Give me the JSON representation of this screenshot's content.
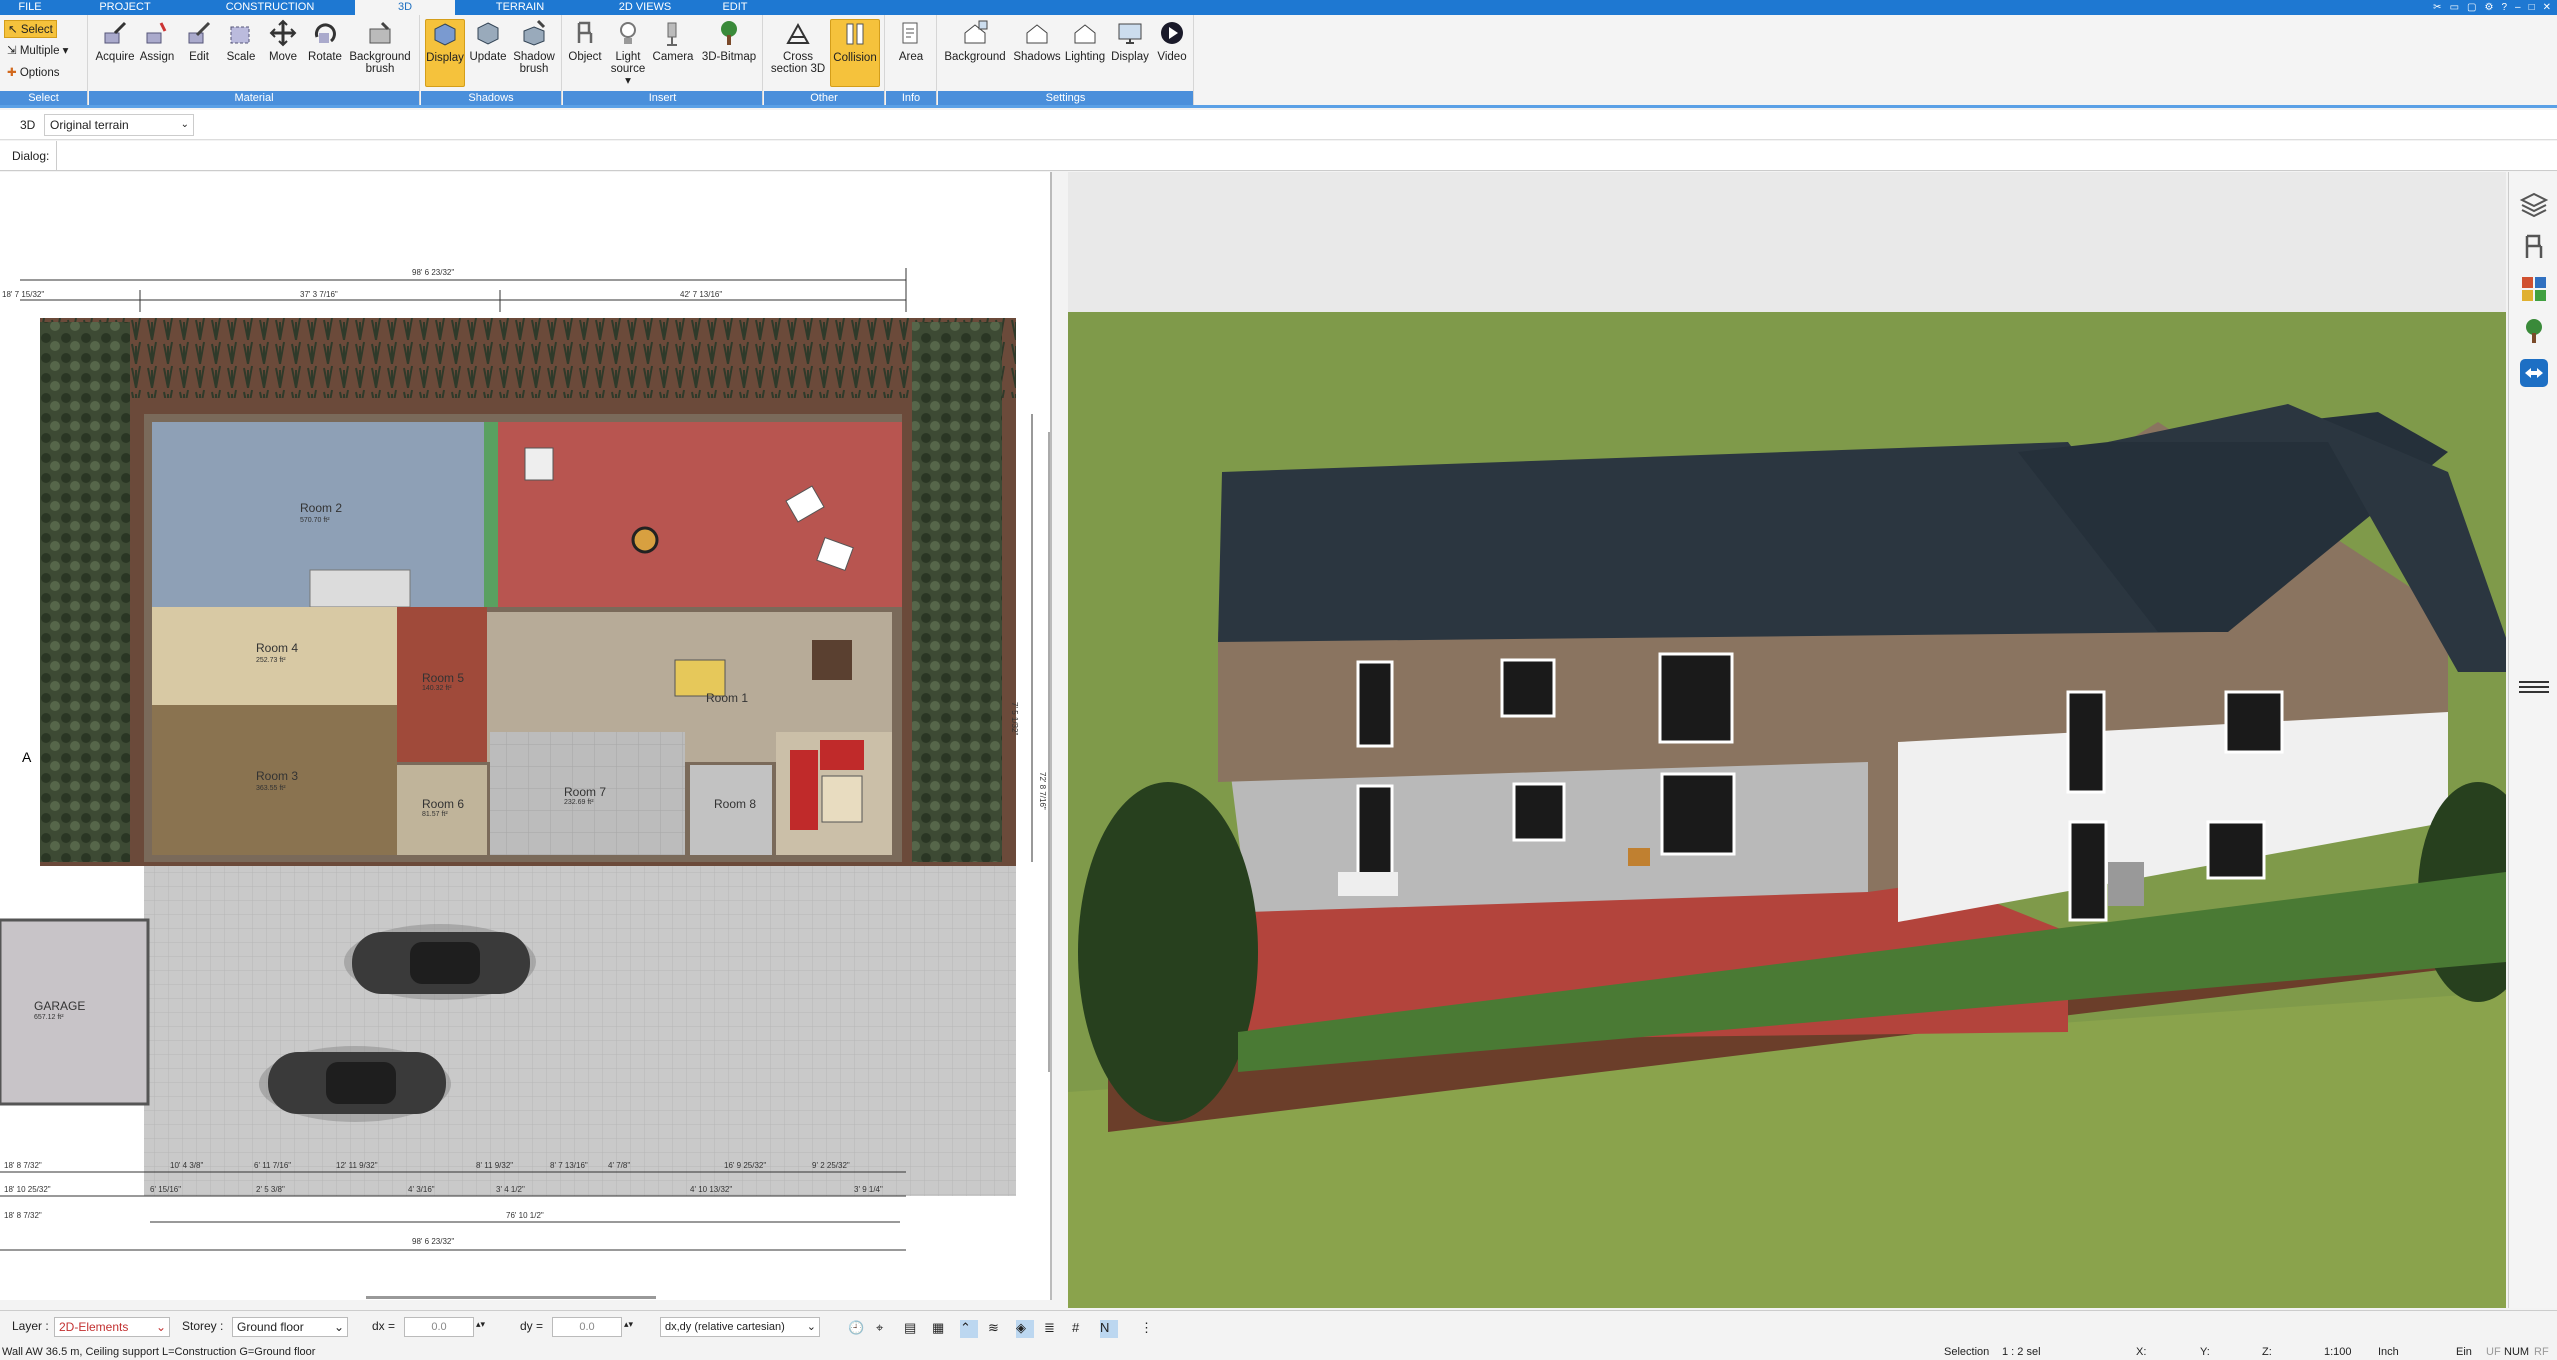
{
  "tabs": [
    {
      "label": "FILE",
      "active": false
    },
    {
      "label": "PROJECT",
      "active": false
    },
    {
      "label": "CONSTRUCTION",
      "active": false
    },
    {
      "label": "3D",
      "active": true
    },
    {
      "label": "TERRAIN",
      "active": false
    },
    {
      "label": "2D VIEWS",
      "active": false
    },
    {
      "label": "EDIT",
      "active": false
    }
  ],
  "ribbon": {
    "select": {
      "select": "Select",
      "multiple": "Multiple",
      "options": "Options",
      "group": "Select"
    },
    "material": {
      "group": "Material",
      "buttons": [
        "Acquire",
        "Assign",
        "Edit",
        "Scale",
        "Move",
        "Rotate",
        "Background brush"
      ]
    },
    "shadows": {
      "group": "Shadows",
      "buttons": [
        "Display",
        "Update",
        "Shadow brush"
      ]
    },
    "insert": {
      "group": "Insert",
      "buttons": [
        "Object",
        "Light source",
        "Camera",
        "3D-Bitmap"
      ]
    },
    "other": {
      "group": "Other",
      "buttons": [
        "Cross section 3D",
        "Collision"
      ]
    },
    "info": {
      "group": "Info",
      "buttons": [
        "Area"
      ]
    },
    "settings": {
      "group": "Settings",
      "buttons": [
        "Background",
        "Shadows",
        "Lighting",
        "Display",
        "Video"
      ]
    }
  },
  "viewbar": {
    "mode": "3D",
    "terrain": "Original terrain"
  },
  "dialog": {
    "label": "Dialog:"
  },
  "plan": {
    "rooms": [
      {
        "name": "Room 2",
        "area": "570.70 ft²"
      },
      {
        "name": "Room 4",
        "area": "252.73 ft²"
      },
      {
        "name": "Room 3",
        "area": "363.55 ft²"
      },
      {
        "name": "Room 5",
        "area": "140.32 ft²"
      },
      {
        "name": "Room 1",
        "area": ""
      },
      {
        "name": "Room 7",
        "area": "232.69 ft²"
      },
      {
        "name": "Room 6",
        "area": "81.57 ft²"
      },
      {
        "name": "Room 8",
        "area": ""
      },
      {
        "name": "GARAGE",
        "area": "657.12 ft²"
      }
    ],
    "dims_top": [
      "98' 6 23/32\"",
      "37' 3 7/16\"",
      "42' 7 13/16\"",
      "18' 7 15/32\""
    ],
    "dims_bottom": [
      "18' 8 7/32\"",
      "18' 10 25/32\"",
      "18' 8 7/32\"",
      "76' 10 1/2\"",
      "98' 6 23/32\""
    ],
    "dims_side": [
      "72' 8 7/16\"",
      "7' 5 1/32\""
    ],
    "dims_row1": [
      "10' 4 3/8\"",
      "6' 11 7/16\"",
      "12' 11 9/32\"",
      "8' 11 9/32\"",
      "8' 7 13/16\"",
      "4' 7/8\"",
      "16' 9 25/32\"",
      "9' 2 25/32\""
    ],
    "dims_row2": [
      "6' 15/16\"",
      "2' 5 3/8\"",
      "4' 3/16\"",
      "3' 4 1/2\"",
      "4' 10 13/32\"",
      "3' 9 1/4\""
    ]
  },
  "toolbar": {
    "layer_label": "Layer :",
    "layer_value": "2D-Elements",
    "storey_label": "Storey :",
    "storey_value": "Ground floor",
    "dx_label": "dx =",
    "dx_value": "0.0",
    "dy_label": "dy =",
    "dy_value": "0.0",
    "coord_mode": "dx,dy (relative cartesian)"
  },
  "status": {
    "message": "Wall AW 36.5 m, Ceiling support L=Construction G=Ground floor",
    "selection_label": "Selection",
    "selection_value": "1 : 2 sel",
    "x_label": "X:",
    "y_label": "Y:",
    "z_label": "Z:",
    "scale": "1:100",
    "unit": "Inch",
    "flags": [
      "Ein",
      "UF",
      "NUM",
      "RF"
    ]
  },
  "colors": {
    "accent": "#1e78d2",
    "highlight": "#f5c23c",
    "roof": "#2b3640",
    "grass": "#7f9a4a",
    "terrace": "#b3443c"
  }
}
